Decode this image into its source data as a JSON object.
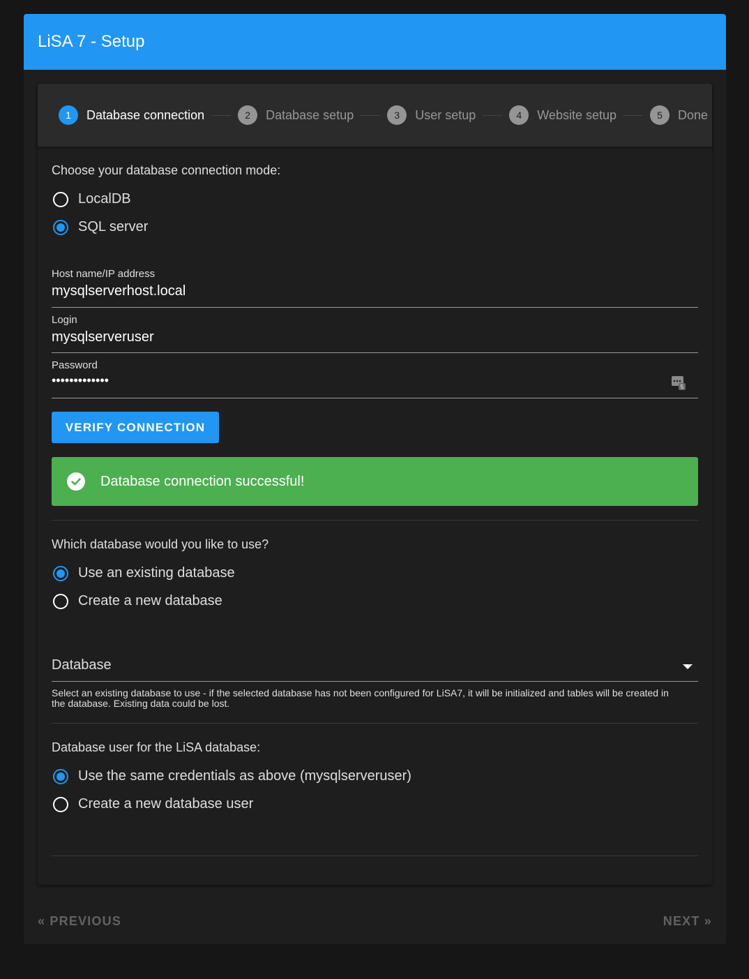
{
  "app": {
    "title": "LiSA 7 - Setup"
  },
  "stepper": {
    "steps": [
      {
        "num": "1",
        "label": "Database connection"
      },
      {
        "num": "2",
        "label": "Database setup"
      },
      {
        "num": "3",
        "label": "User setup"
      },
      {
        "num": "4",
        "label": "Website setup"
      },
      {
        "num": "5",
        "label": "Done"
      }
    ],
    "active_step": 1
  },
  "connection": {
    "mode_label": "Choose your database connection mode:",
    "options": [
      "LocalDB",
      "SQL server"
    ],
    "selected": "SQL server",
    "host": {
      "label": "Host name/IP address",
      "value": "mysqlserverhost.local"
    },
    "login": {
      "label": "Login",
      "value": "mysqlserveruser"
    },
    "password": {
      "label": "Password",
      "value": "•••••••••••••"
    },
    "verify_button": "VERIFY CONNECTION",
    "success_message": "Database connection successful!"
  },
  "database": {
    "question": "Which database would you like to use?",
    "options": [
      "Use an existing database",
      "Create a new database"
    ],
    "selected": "Use an existing database",
    "select_label": "Database",
    "hint": "Select an existing database to use - if the selected database has not been configured for LiSA7, it will be initialized and tables will be created in the database. Existing data could be lost."
  },
  "db_user": {
    "question": "Database user for the LiSA database:",
    "options": [
      "Use the same credentials as above (mysqlserveruser)",
      "Create a new database user"
    ],
    "selected": "Use the same credentials as above (mysqlserveruser)"
  },
  "footer": {
    "previous": "« PREVIOUS",
    "next": "NEXT »"
  },
  "colors": {
    "accent": "#2196f3",
    "success": "#4caf50",
    "background": "#1e1e1e"
  }
}
